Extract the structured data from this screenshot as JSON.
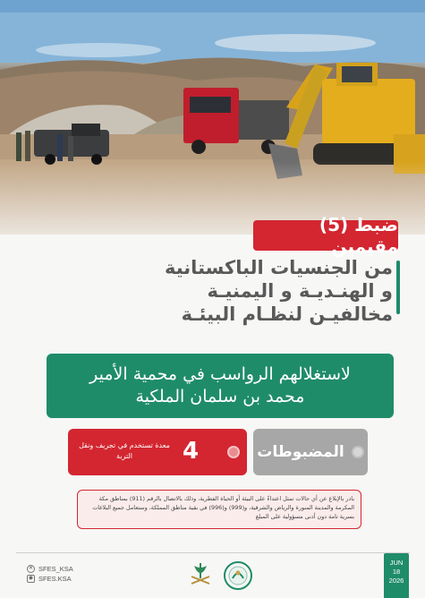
{
  "headline": {
    "tag": "ضبط (5) مقيمين",
    "lines": [
      "من الجنسيات الباكستانية",
      "و الهنـديـة و اليمنيـة",
      "مخالفيـن لنظـام البيئـة"
    ]
  },
  "banner": {
    "line1": "لاستغلالهم الرواسب في محمية الأمير",
    "line2": "محمد بن سلمان الملكية"
  },
  "seized": {
    "label": "المضبوطات",
    "count": "4",
    "description": "معدة تستخدم في تجريف ونقل التربة"
  },
  "notice": {
    "text": "بادر بالإبلاغ عن أي حالات تمثل اعتداءً على البيئة أو الحياة الفطرية، وذلك بالاتصال بالرقم (911) بمناطق مكة المكرمة والمدينة المنورة والرياض والشرقية، و(999) و(996) في بقية مناطق المملكة، وستعامل جميع البلاغات بسرية تامة دون أدنى مسؤولية على المبلغ"
  },
  "footer": {
    "handles": [
      "SFES_KSA",
      "SFES.KSA"
    ],
    "date": {
      "month": "JUN",
      "day": "18",
      "year": "2026"
    }
  },
  "colors": {
    "red": "#d32630",
    "green": "#1f8c69",
    "grey": "#a7a7a7",
    "headline_text": "#595959"
  },
  "icons": [
    "x-icon",
    "instagram-icon",
    "saudi-emblem-icon",
    "center-logo-icon"
  ]
}
